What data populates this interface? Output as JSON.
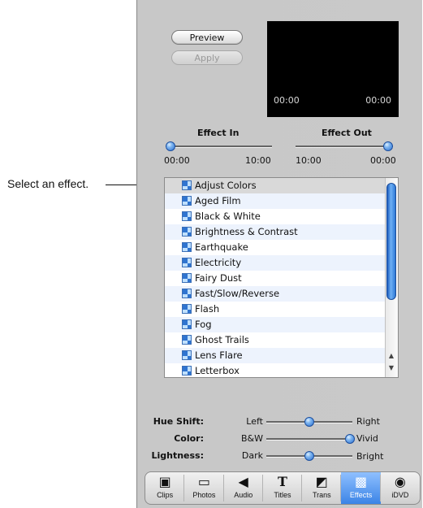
{
  "callout": "Select an effect.",
  "buttons": {
    "preview": "Preview",
    "apply": "Apply"
  },
  "preview": {
    "time_left": "00:00",
    "time_right": "00:00"
  },
  "effect_in": {
    "label": "Effect In",
    "start": "00:00",
    "end": "10:00",
    "value": 0
  },
  "effect_out": {
    "label": "Effect Out",
    "start": "10:00",
    "end": "00:00",
    "value": 0
  },
  "effects": [
    "Adjust Colors",
    "Aged Film",
    "Black & White",
    "Brightness & Contrast",
    "Earthquake",
    "Electricity",
    "Fairy Dust",
    "Fast/Slow/Reverse",
    "Flash",
    "Fog",
    "Ghost Trails",
    "Lens Flare",
    "Letterbox"
  ],
  "selected_effect": "Adjust Colors",
  "controls": [
    {
      "label": "Hue Shift:",
      "min": "Left",
      "max": "Right",
      "value": 0.5
    },
    {
      "label": "Color:",
      "min": "B&W",
      "max": "Vivid",
      "value": 1.0
    },
    {
      "label": "Lightness:",
      "min": "Dark",
      "max": "Bright",
      "value": 0.5
    }
  ],
  "tabs": [
    {
      "label": "Clips",
      "icon": "clips-icon"
    },
    {
      "label": "Photos",
      "icon": "photos-icon"
    },
    {
      "label": "Audio",
      "icon": "audio-icon"
    },
    {
      "label": "Titles",
      "icon": "titles-icon"
    },
    {
      "label": "Trans",
      "icon": "transitions-icon"
    },
    {
      "label": "Effects",
      "icon": "effects-icon"
    },
    {
      "label": "iDVD",
      "icon": "idvd-icon"
    }
  ],
  "active_tab": "Effects",
  "colors": {
    "accent": "#2f74d0",
    "list_stripe": "#edf3fd",
    "selected_row": "#d9d9d9"
  }
}
